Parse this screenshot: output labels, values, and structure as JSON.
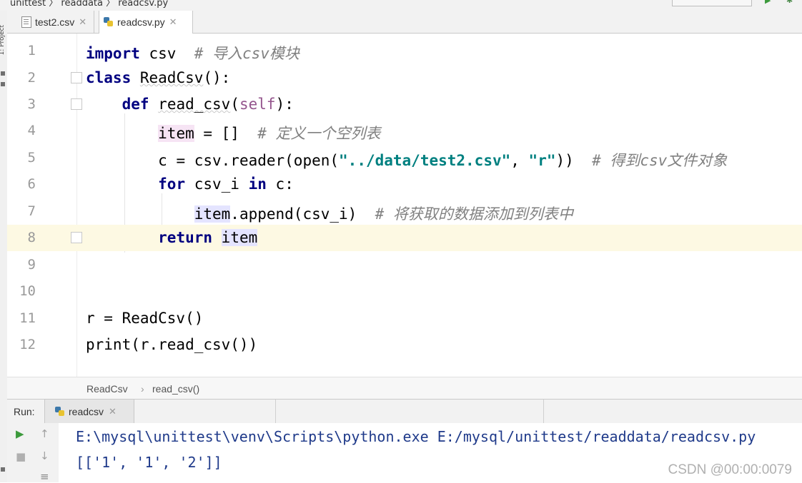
{
  "top": {
    "breadcrumb": "unittest 〉 readdata 〉 readcsv.py"
  },
  "leftstrip": {
    "label": "1: Project"
  },
  "tabs": [
    {
      "label": "test2.csv",
      "icon": "csv-file-icon",
      "active": false
    },
    {
      "label": "readcsv.py",
      "icon": "python-file-icon",
      "active": true
    }
  ],
  "editor": {
    "lines": [
      "1",
      "2",
      "3",
      "4",
      "5",
      "6",
      "7",
      "8",
      "9",
      "10",
      "11",
      "12"
    ],
    "current_line": "8",
    "code": {
      "l1": {
        "kw": "import",
        "rest": " csv  ",
        "comment": "# 导入csv模块"
      },
      "l2": {
        "kw": "class",
        "name": "ReadCsv",
        "rest": "():"
      },
      "l3": {
        "kw": "def",
        "name": "read_csv",
        "open": "(",
        "self": "self",
        "close": "):"
      },
      "l4": {
        "var": "item",
        "rest": " = []  ",
        "comment": "# 定义一个空列表"
      },
      "l5": {
        "pre": "c = csv.reader(open(",
        "s1": "\"../data/test2.csv\"",
        "mid": ", ",
        "s2": "\"r\"",
        "post": "))  ",
        "comment": "# 得到csv文件对象"
      },
      "l6": {
        "kw1": "for",
        "mid": " csv_i ",
        "kw2": "in",
        "rest": " c:"
      },
      "l7": {
        "var": "item",
        "rest": ".append(csv_i)  ",
        "comment": "# 将获取的数据添加到列表中"
      },
      "l8": {
        "kw": "return",
        "var": "item"
      },
      "l11": "r = ReadCsv()",
      "l12": "print(r.read_csv())"
    }
  },
  "breadcrumb_bar": {
    "class": "ReadCsv",
    "sep": "›",
    "method": "read_csv()"
  },
  "run": {
    "label": "Run:",
    "tab": "readcsv",
    "output": [
      "E:\\mysql\\unittest\\venv\\Scripts\\python.exe E:/mysql/unittest/readdata/readcsv.py",
      "[['1', '1', '2']]"
    ]
  },
  "watermark": "CSDN @00:00:0079",
  "colors": {
    "keyword": "#000080",
    "comment": "#808080",
    "string": "#008080",
    "self": "#94558d",
    "current_line": "#fdf9e3",
    "console_text": "#1f3a8a"
  }
}
